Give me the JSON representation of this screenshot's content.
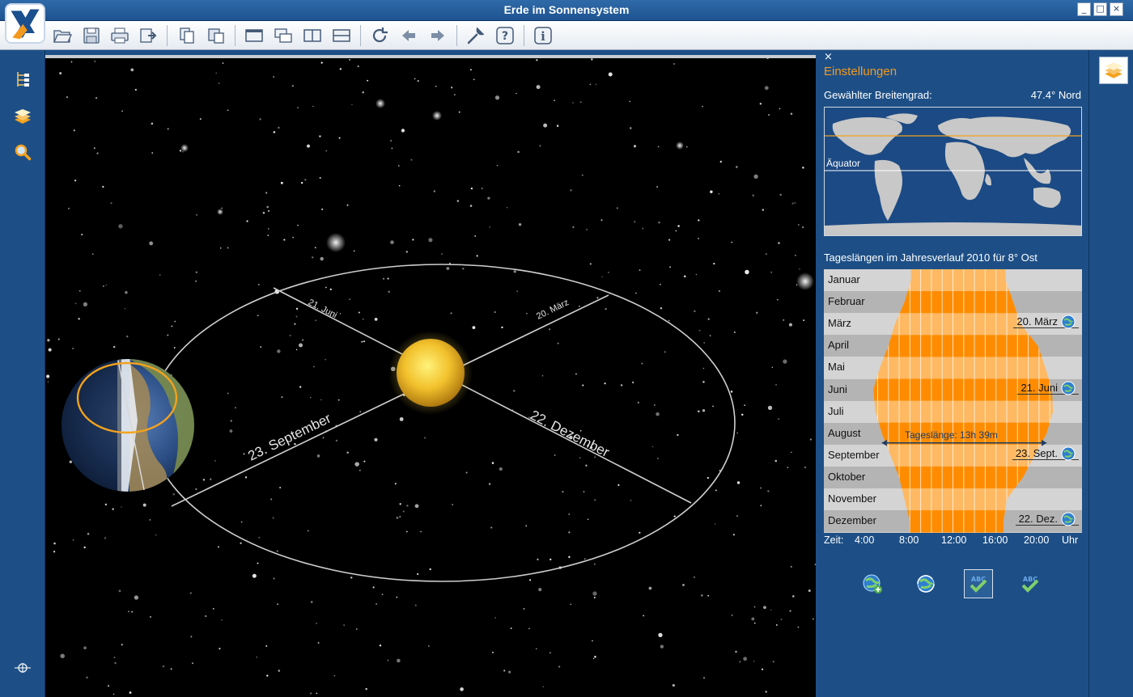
{
  "window": {
    "title": "Erde im Sonnensystem",
    "controls": [
      "_",
      "□",
      "×"
    ]
  },
  "toolbar": {
    "icons": [
      "open-folder-icon",
      "save-icon",
      "print-icon",
      "export-icon",
      "copy-icon",
      "paste-icon",
      "view-single-icon",
      "view-cascade-icon",
      "view-split-vertical-icon",
      "view-split-horizontal-icon",
      "refresh-icon",
      "back-arrow-icon",
      "forward-arrow-icon",
      "wrench-icon",
      "help-icon",
      "info-icon"
    ]
  },
  "sidebar": {
    "icons": [
      "tree-icon",
      "layers-icon",
      "magnifier-icon",
      "crosshair-icon"
    ]
  },
  "scene": {
    "orbit_labels": {
      "june": "21. Juni",
      "march": "20. März",
      "september": "23. September",
      "december": "22. Dezember"
    }
  },
  "settings": {
    "close": "×",
    "title": "Einstellungen",
    "latitude_label": "Gewählter Breitengrad:",
    "latitude_value": "47.4° Nord",
    "equator_label": "Äquator",
    "daylength_title": "Tageslängen im Jahresverlauf 2010 für 8° Ost",
    "months": [
      "Januar",
      "Februar",
      "März",
      "April",
      "Mai",
      "Juni",
      "Juli",
      "August",
      "September",
      "Oktober",
      "November",
      "Dezember"
    ],
    "events": [
      {
        "label": "20. März",
        "month_index": 2
      },
      {
        "label": "21. Juni",
        "month_index": 5
      },
      {
        "label": "23. Sept.",
        "month_index": 8
      },
      {
        "label": "22. Dez.",
        "month_index": 11
      }
    ],
    "daylength_readout": "Tageslänge: 13h 39m",
    "time_axis": {
      "prefix": "Zeit:",
      "ticks": [
        "4:00",
        "8:00",
        "12:00",
        "16:00",
        "20:00"
      ],
      "unit": "Uhr"
    },
    "bottom_icons": [
      "globe-add-icon",
      "globe-rotate-icon",
      "abc-check-active-icon",
      "abc-check-icon"
    ]
  },
  "chart_data": {
    "type": "area",
    "title": "Tageslängen im Jahresverlauf 2010 für 8° Ost",
    "categories": [
      "Januar",
      "Februar",
      "März",
      "April",
      "Mai",
      "Juni",
      "Juli",
      "August",
      "September",
      "Oktober",
      "November",
      "Dezember"
    ],
    "series": [
      {
        "name": "sunrise",
        "values": [
          8.1,
          7.5,
          6.6,
          6.0,
          5.2,
          4.6,
          4.8,
          5.4,
          6.2,
          7.0,
          7.5,
          8.0
        ]
      },
      {
        "name": "sunset",
        "values": [
          16.9,
          17.6,
          18.3,
          19.9,
          20.6,
          21.2,
          21.3,
          20.7,
          19.6,
          18.5,
          17.0,
          16.7
        ]
      }
    ],
    "xlabel": "Zeit",
    "xlim": [
      0,
      24
    ],
    "x_unit": "Uhr"
  },
  "colors": {
    "accent": "#f39a1e",
    "panel": "#1d4f86",
    "day": "#ffb963",
    "day_stripe": "#ff8c00"
  }
}
